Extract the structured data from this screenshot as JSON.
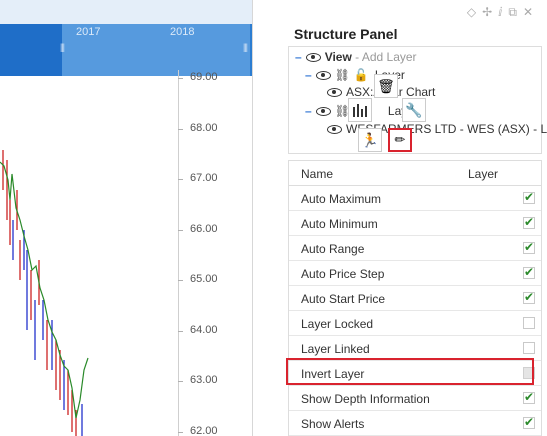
{
  "navigator": {
    "years": [
      "2017",
      "2018"
    ]
  },
  "y_axis": {
    "ticks": [
      "69.00",
      "68.00",
      "67.00",
      "66.00",
      "65.00",
      "64.00",
      "63.00",
      "62.00"
    ]
  },
  "window_icons": [
    "diamond-icon",
    "pin-icon",
    "info-icon",
    "restore-icon",
    "close-icon"
  ],
  "panel": {
    "title": "Structure Panel",
    "tree": {
      "view_label": "View",
      "add_layer": " - Add Layer",
      "layer1_label": "Layer",
      "layer1_child": "ASX:A   Bar Chart",
      "layer2_label": "Layer",
      "layer2_child": "WESFARMERS LTD - WES (ASX) - Line C"
    },
    "hover_tools": [
      "trash-icon",
      "bar-chart-icon",
      "wrench-icon",
      "runner-icon",
      "pencil-icon"
    ],
    "properties": {
      "col_name": "Name",
      "col_layer": "Layer",
      "rows": [
        {
          "label": "Auto Maximum",
          "checked": true
        },
        {
          "label": "Auto Minimum",
          "checked": true
        },
        {
          "label": "Auto Range",
          "checked": true
        },
        {
          "label": "Auto Price Step",
          "checked": true
        },
        {
          "label": "Auto Start Price",
          "checked": true
        },
        {
          "label": "Layer Locked",
          "checked": false
        },
        {
          "label": "Layer Linked",
          "checked": false
        },
        {
          "label": "Invert Layer",
          "checked": false,
          "disabled": true
        },
        {
          "label": "Show Depth Information",
          "checked": true
        },
        {
          "label": "Show Alerts",
          "checked": true
        }
      ]
    }
  },
  "colors": {
    "accent_blue": "#2c7dd1",
    "highlight_red": "#d9232e",
    "check_green": "#2b8a2b",
    "price_line_green": "#2a8a2a",
    "bar_up_red": "#cc2222",
    "bar_down_blue": "#2233cc"
  }
}
